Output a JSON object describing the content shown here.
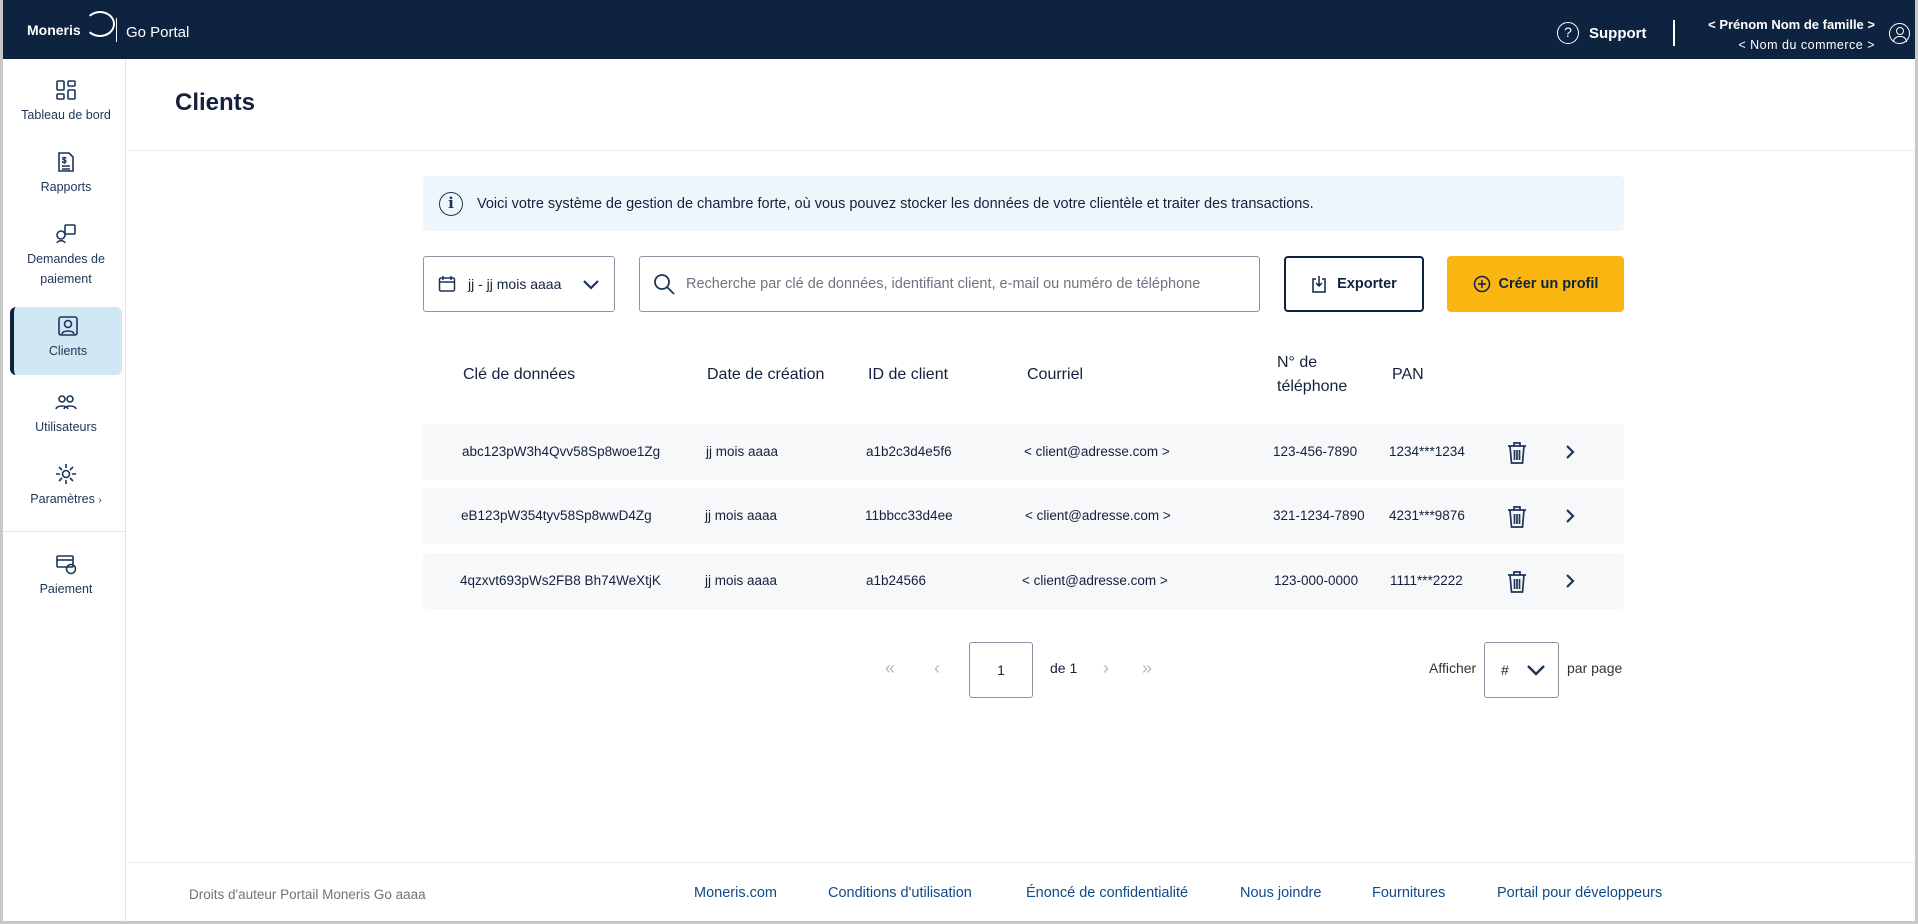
{
  "topbar": {
    "logo_text": "Moneris",
    "app_name": "Go Portal",
    "support_label": "Support",
    "user_name": "< Prénom Nom de famille >",
    "merchant_name": "< Nom du commerce >"
  },
  "sidebar": {
    "items": [
      {
        "label": "Tableau de bord",
        "icon": "dashboard-icon"
      },
      {
        "label": "Rapports",
        "icon": "reports-icon"
      },
      {
        "label": "Demandes de paiement",
        "icon": "payment-request-icon"
      },
      {
        "label": "Clients",
        "icon": "customer-icon"
      },
      {
        "label": "Utilisateurs",
        "icon": "users-icon"
      },
      {
        "label": "Paramètres",
        "icon": "gear-icon"
      },
      {
        "label": "Paiement",
        "icon": "payment-icon"
      }
    ],
    "active": "Clients"
  },
  "page": {
    "title": "Clients",
    "info_text": "Voici votre système de gestion de chambre forte, où vous pouvez stocker les données de votre clientèle et traiter des transactions."
  },
  "filters": {
    "date_range": "jj  - jj mois aaaa",
    "search_placeholder": "Recherche par clé de données, identifiant client, e-mail ou numéro de téléphone",
    "export_label": "Exporter",
    "create_label": "Créer un profil"
  },
  "table": {
    "headers": {
      "data_key": "Clé de données",
      "created": "Date de création",
      "client_id": "ID de client",
      "email": "Courriel",
      "phone_1": "N° de",
      "phone_2": "téléphone",
      "pan": "PAN"
    },
    "rows": [
      {
        "data_key": "abc123pW3h4Qvv58Sp8woe1Zg",
        "created": "jj mois aaaa",
        "client_id": "a1b2c3d4e5f6",
        "email": "< client@adresse.com >",
        "phone": "123-456-7890",
        "pan": "1234***1234"
      },
      {
        "data_key": "eB123pW354tyv58Sp8wwD4Zg",
        "created": "jj mois aaaa",
        "client_id": "11bbcc33d4ee",
        "email": "< client@adresse.com >",
        "phone": "321-1234-7890",
        "pan": "4231***9876"
      },
      {
        "data_key": "4qzxvt693pWs2FB8 Bh74WeXtjK",
        "created": "jj mois aaaa",
        "client_id": "a1b24566",
        "email": "< client@adresse.com >",
        "phone": "123-000-0000",
        "pan": "1111***2222"
      }
    ]
  },
  "pagination": {
    "current_page": "1",
    "of_label": "de 1",
    "show_label": "Afficher",
    "per_page_value": "#",
    "per_page_label": "par page"
  },
  "footer": {
    "copyright": "Droits d'auteur Portail Moneris Go  aaaa",
    "links": [
      "Moneris.com",
      "Conditions d'utilisation",
      "Énoncé de confidentialité",
      "Nous joindre",
      "Fournitures",
      "Portail pour développeurs"
    ]
  },
  "colors": {
    "topbar": "#0d2340",
    "active_nav": "#cfe8f3",
    "accent": "#fab510",
    "link": "#0f4a8a"
  }
}
